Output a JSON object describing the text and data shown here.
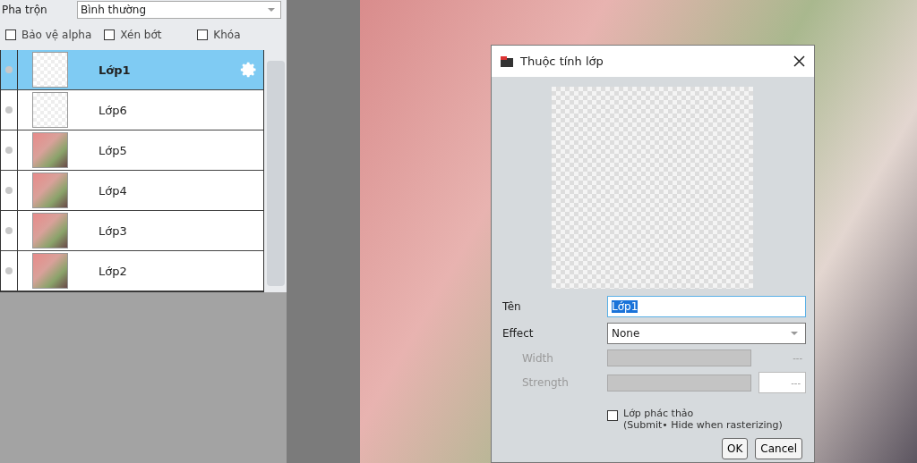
{
  "blend": {
    "label": "Pha trộn",
    "value": "Bình thường"
  },
  "layer_options": [
    {
      "label": "Bảo vệ alpha",
      "checked": false
    },
    {
      "label": "Xén bớt",
      "checked": false
    },
    {
      "label": "Khóa",
      "checked": false
    }
  ],
  "layers": [
    {
      "name": "Lớp1",
      "kind": "transparent",
      "selected": true
    },
    {
      "name": "Lớp6",
      "kind": "transparent",
      "selected": false
    },
    {
      "name": "Lớp5",
      "kind": "photo",
      "selected": false
    },
    {
      "name": "Lớp4",
      "kind": "photo",
      "selected": false
    },
    {
      "name": "Lớp3",
      "kind": "photo",
      "selected": false
    },
    {
      "name": "Lớp2",
      "kind": "photo",
      "selected": false
    }
  ],
  "dialog": {
    "title": "Thuộc tính lớp",
    "name_field": {
      "label": "Tên",
      "value": "Lớp1",
      "text_selected": true
    },
    "effect": {
      "label": "Effect",
      "value": "None"
    },
    "width": {
      "label": "Width",
      "reading": "---",
      "disabled": true
    },
    "strength": {
      "label": "Strength",
      "reading": "---",
      "disabled": true
    },
    "draft": {
      "label": "Lớp phác thảo",
      "note": "(Submit• Hide when rasterizing)",
      "checked": false
    },
    "buttons": [
      "OK",
      "Cancel"
    ]
  }
}
